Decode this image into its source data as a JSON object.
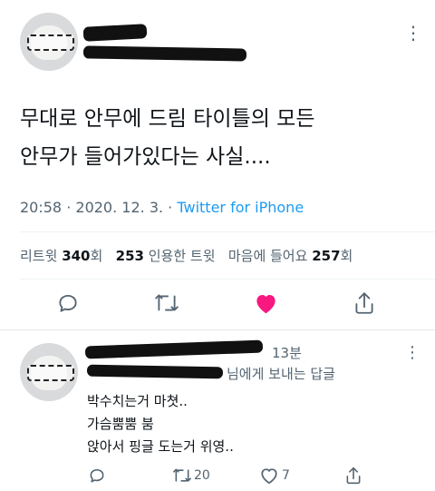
{
  "main_tweet": {
    "text_line1": "무대로 안무에 드림 타이틀의 모든",
    "text_line2": "안무가 들어가있다는 사실....",
    "time": "20:58",
    "date": "2020. 12. 3.",
    "separator": "·",
    "source": "Twitter for iPhone",
    "stats": {
      "retweets_label": "리트윗",
      "retweets_count": "340",
      "retweets_unit": "회",
      "quotes_count": "253",
      "quotes_label": "인용한 트윗",
      "likes_label": "마음에 들어요",
      "likes_count": "257",
      "likes_unit": "회"
    },
    "menu_dots": "⋮"
  },
  "reply": {
    "time_ago": "13분",
    "reply_to_suffix": "님에게 보내는 답글",
    "line1": "박수치는거 마쳣..",
    "line2": "가슴뿜뿜 붐",
    "line3": "앉아서 핑글 도는거 위영..",
    "retweet_count": "20",
    "like_count": "7",
    "menu_dots": "⋮"
  },
  "colors": {
    "link": "#1d9bf0",
    "muted": "#536471",
    "like": "#f91880",
    "text": "#0f1419"
  },
  "icons": [
    "reply-icon",
    "retweet-icon",
    "heart-icon",
    "share-icon",
    "more-icon"
  ]
}
